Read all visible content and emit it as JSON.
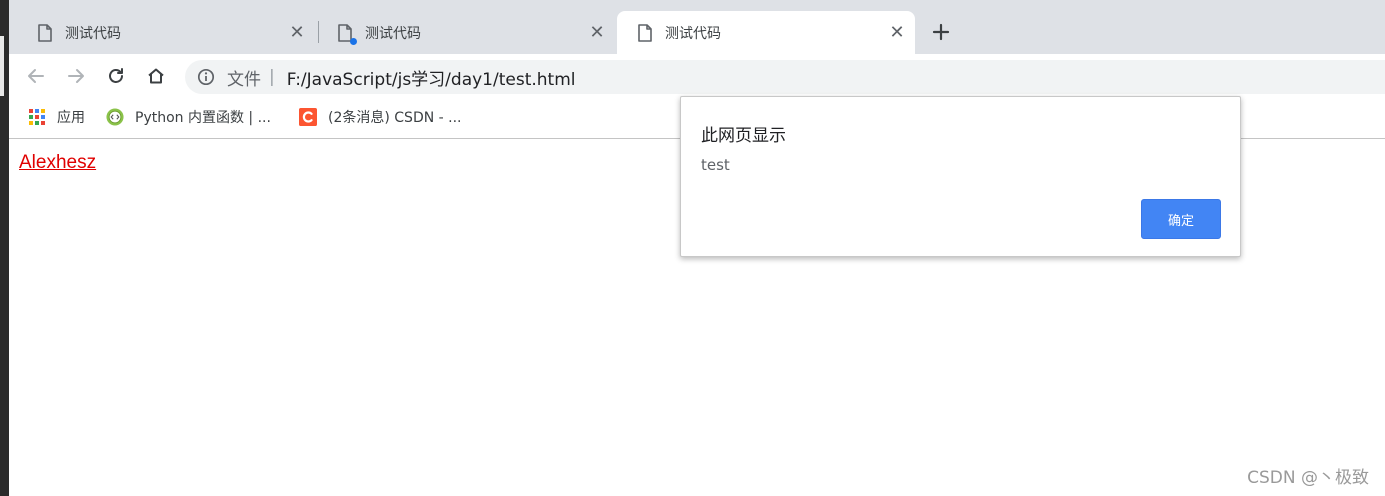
{
  "browser": {
    "tabs": [
      {
        "title": "测试代码",
        "icon": "document-icon",
        "loading": false
      },
      {
        "title": "测试代码",
        "icon": "document-icon",
        "loading": true
      },
      {
        "title": "测试代码",
        "icon": "document-icon",
        "loading": false,
        "active": true
      }
    ],
    "close_symbol": "✕",
    "new_tab_icon": "plus-icon"
  },
  "toolbar": {
    "back_icon": "arrow-left-icon",
    "forward_icon": "arrow-right-icon",
    "reload_icon": "reload-icon",
    "home_icon": "home-icon",
    "omnibox": {
      "info_icon": "info-icon",
      "scheme_label": "文件",
      "separator": "|",
      "url": "F:/JavaScript/js学习/day1/test.html"
    }
  },
  "bookmarks": [
    {
      "label": "应用",
      "icon": "apps-grid-icon"
    },
    {
      "label": "Python 内置函数 | ...",
      "icon": "code-icon"
    },
    {
      "label": "(2条消息) CSDN - ...",
      "icon": "csdn-icon"
    }
  ],
  "page": {
    "link_text": "Alexhesz",
    "link_color": "#e00000"
  },
  "dialog": {
    "title": "此网页显示",
    "message": "test",
    "ok_label": "确定",
    "ok_color": "#4285f4"
  },
  "watermark": "CSDN @丶极致"
}
